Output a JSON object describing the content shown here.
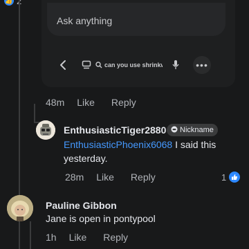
{
  "top": {
    "reaction_count": "2",
    "reaction_color": "#2d88ff"
  },
  "ai_box": {
    "placeholder": "Ask anything",
    "search_text": "can you use shrinkwrap"
  },
  "first_actions": {
    "time": "48m",
    "like": "Like",
    "reply": "Reply"
  },
  "reply": {
    "author": "EnthusiasticTiger2880",
    "badge": "Nickname",
    "mention": "EnthusiasticPhoenix6068",
    "text_after_mention": " I said this yesterday.",
    "time": "28m",
    "like": "Like",
    "reply": "Reply",
    "reaction_count": "1"
  },
  "comment2": {
    "author": "Pauline Gibbon",
    "text": "Jane is open in pontypool",
    "time": "1h",
    "like": "Like",
    "reply": "Reply"
  },
  "colors": {
    "background": "#18191a",
    "mention": "#4599ff",
    "muted": "#b0b3b8"
  }
}
